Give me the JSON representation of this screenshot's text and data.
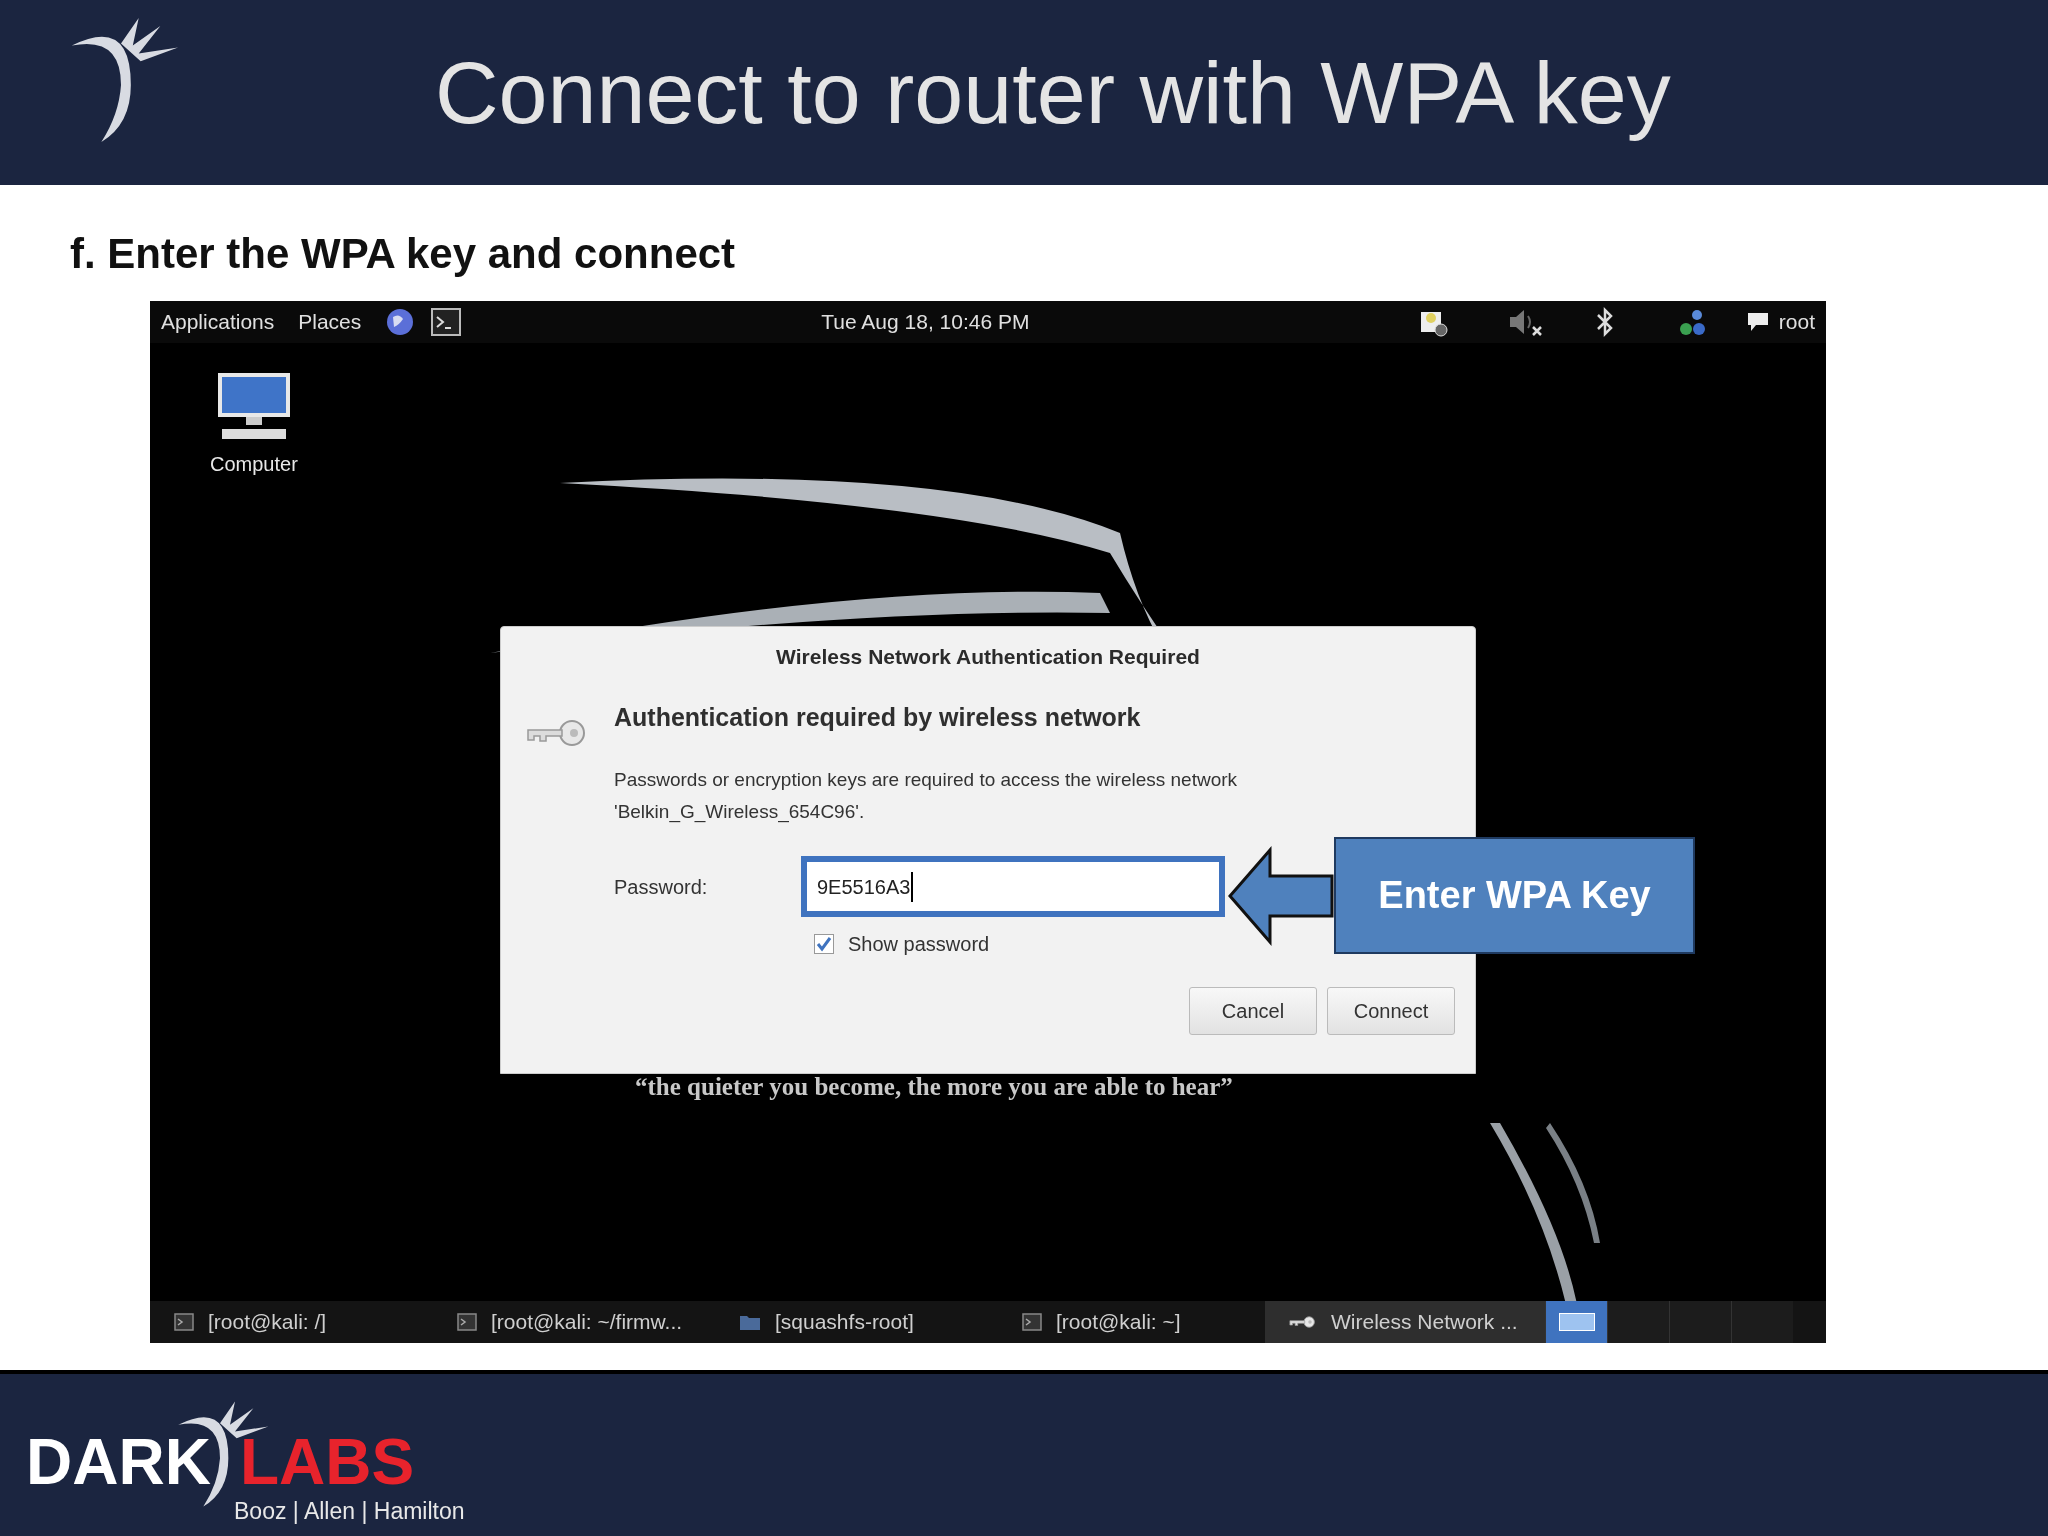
{
  "slide": {
    "title": "Connect to router with WPA key",
    "heading": "f. Enter the WPA key and connect"
  },
  "top_panel": {
    "menus": [
      "Applications",
      "Places"
    ],
    "clock": "Tue Aug 18, 10:46 PM",
    "user": "root"
  },
  "desktop": {
    "icons": [
      {
        "label": "Computer"
      }
    ],
    "wallpaper_quote": "“the quieter you become, the more you are able to hear”"
  },
  "dialog": {
    "title": "Wireless Network Authentication Required",
    "heading": "Authentication required by wireless network",
    "message_lines": [
      "Passwords or encryption keys are required to access the wireless network",
      "'Belkin_G_Wireless_654C96'."
    ],
    "password_label": "Password:",
    "password_value": "9E5516A3",
    "show_password": {
      "label": "Show password",
      "checked": true
    },
    "buttons": [
      "Cancel",
      "Connect"
    ]
  },
  "callout": {
    "text": "Enter WPA Key"
  },
  "taskbar": {
    "items": [
      {
        "label": "[root@kali: /]",
        "kind": "terminal",
        "selected": false
      },
      {
        "label": "[root@kali: ~/firmw...",
        "kind": "terminal",
        "selected": false
      },
      {
        "label": "[squashfs-root]",
        "kind": "folder",
        "selected": false
      },
      {
        "label": "[root@kali: ~]",
        "kind": "terminal",
        "selected": false
      },
      {
        "label": "Wireless Network ...",
        "kind": "key",
        "selected": true
      }
    ],
    "workspaces": [
      {
        "selected": true
      },
      {
        "selected": false
      },
      {
        "selected": false
      },
      {
        "selected": false
      }
    ]
  },
  "footer": {
    "logo_dark": "DARK",
    "logo_labs": "LABS",
    "logo_sub": "Booz | Allen | Hamilton"
  }
}
